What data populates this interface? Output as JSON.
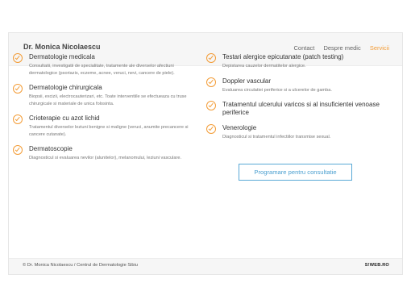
{
  "header": {
    "brand": "Dr. Monica Nicolaescu",
    "nav": [
      "Contact",
      "Despre medic",
      "Servicii"
    ]
  },
  "services": {
    "left": [
      {
        "title": "Dermatologie medicala",
        "desc": "Consultatii, investigatii de specialitate, tratamente ale diverselor afectiuni dermatologice (psoriazis, eczeme, acnee, veruci, nevi, cancere de piele)."
      },
      {
        "title": "Dermatologie chirurgicala",
        "desc": "Biopsii, excizii, electrocauterizari, etc. Toate interventiile se efectueaza cu truse chirurgicale si materiale de unica folosinta."
      },
      {
        "title": "Crioterapie cu azot lichid",
        "desc": "Tratamentul diverselor leziuni benigne si maligne (veruci, anumite precancere si cancere cutanate)."
      },
      {
        "title": "Dermatoscopie",
        "desc": "Diagnosticul si evaluarea nevilor (alunitelor), melanomului, leziuni vasculare."
      }
    ],
    "right": [
      {
        "title": "Testari alergice epicutanate (patch testing)",
        "desc": "Depistarea cauzelor dermatitelor alergice."
      },
      {
        "title": "Doppler vascular",
        "desc": "Evaluarea circulatiei periferice si a ulcerelor de gamba."
      },
      {
        "title": "Tratamentul ulcerului varicos si al insuficientei venoase periferice",
        "desc": ""
      },
      {
        "title": "Venerologie",
        "desc": "Diagnosticul si tratamentul infectiilor transmise sexual."
      }
    ]
  },
  "cta": {
    "label": "Programare pentru consultatie"
  },
  "footer": {
    "text": "© Dr. Monica Nicolaescu / Centrul de Dermatologie Sibiu",
    "logo": "S!WEB.RO"
  },
  "colors": {
    "accent": "#f39c36",
    "cta": "#4a9fd0"
  }
}
